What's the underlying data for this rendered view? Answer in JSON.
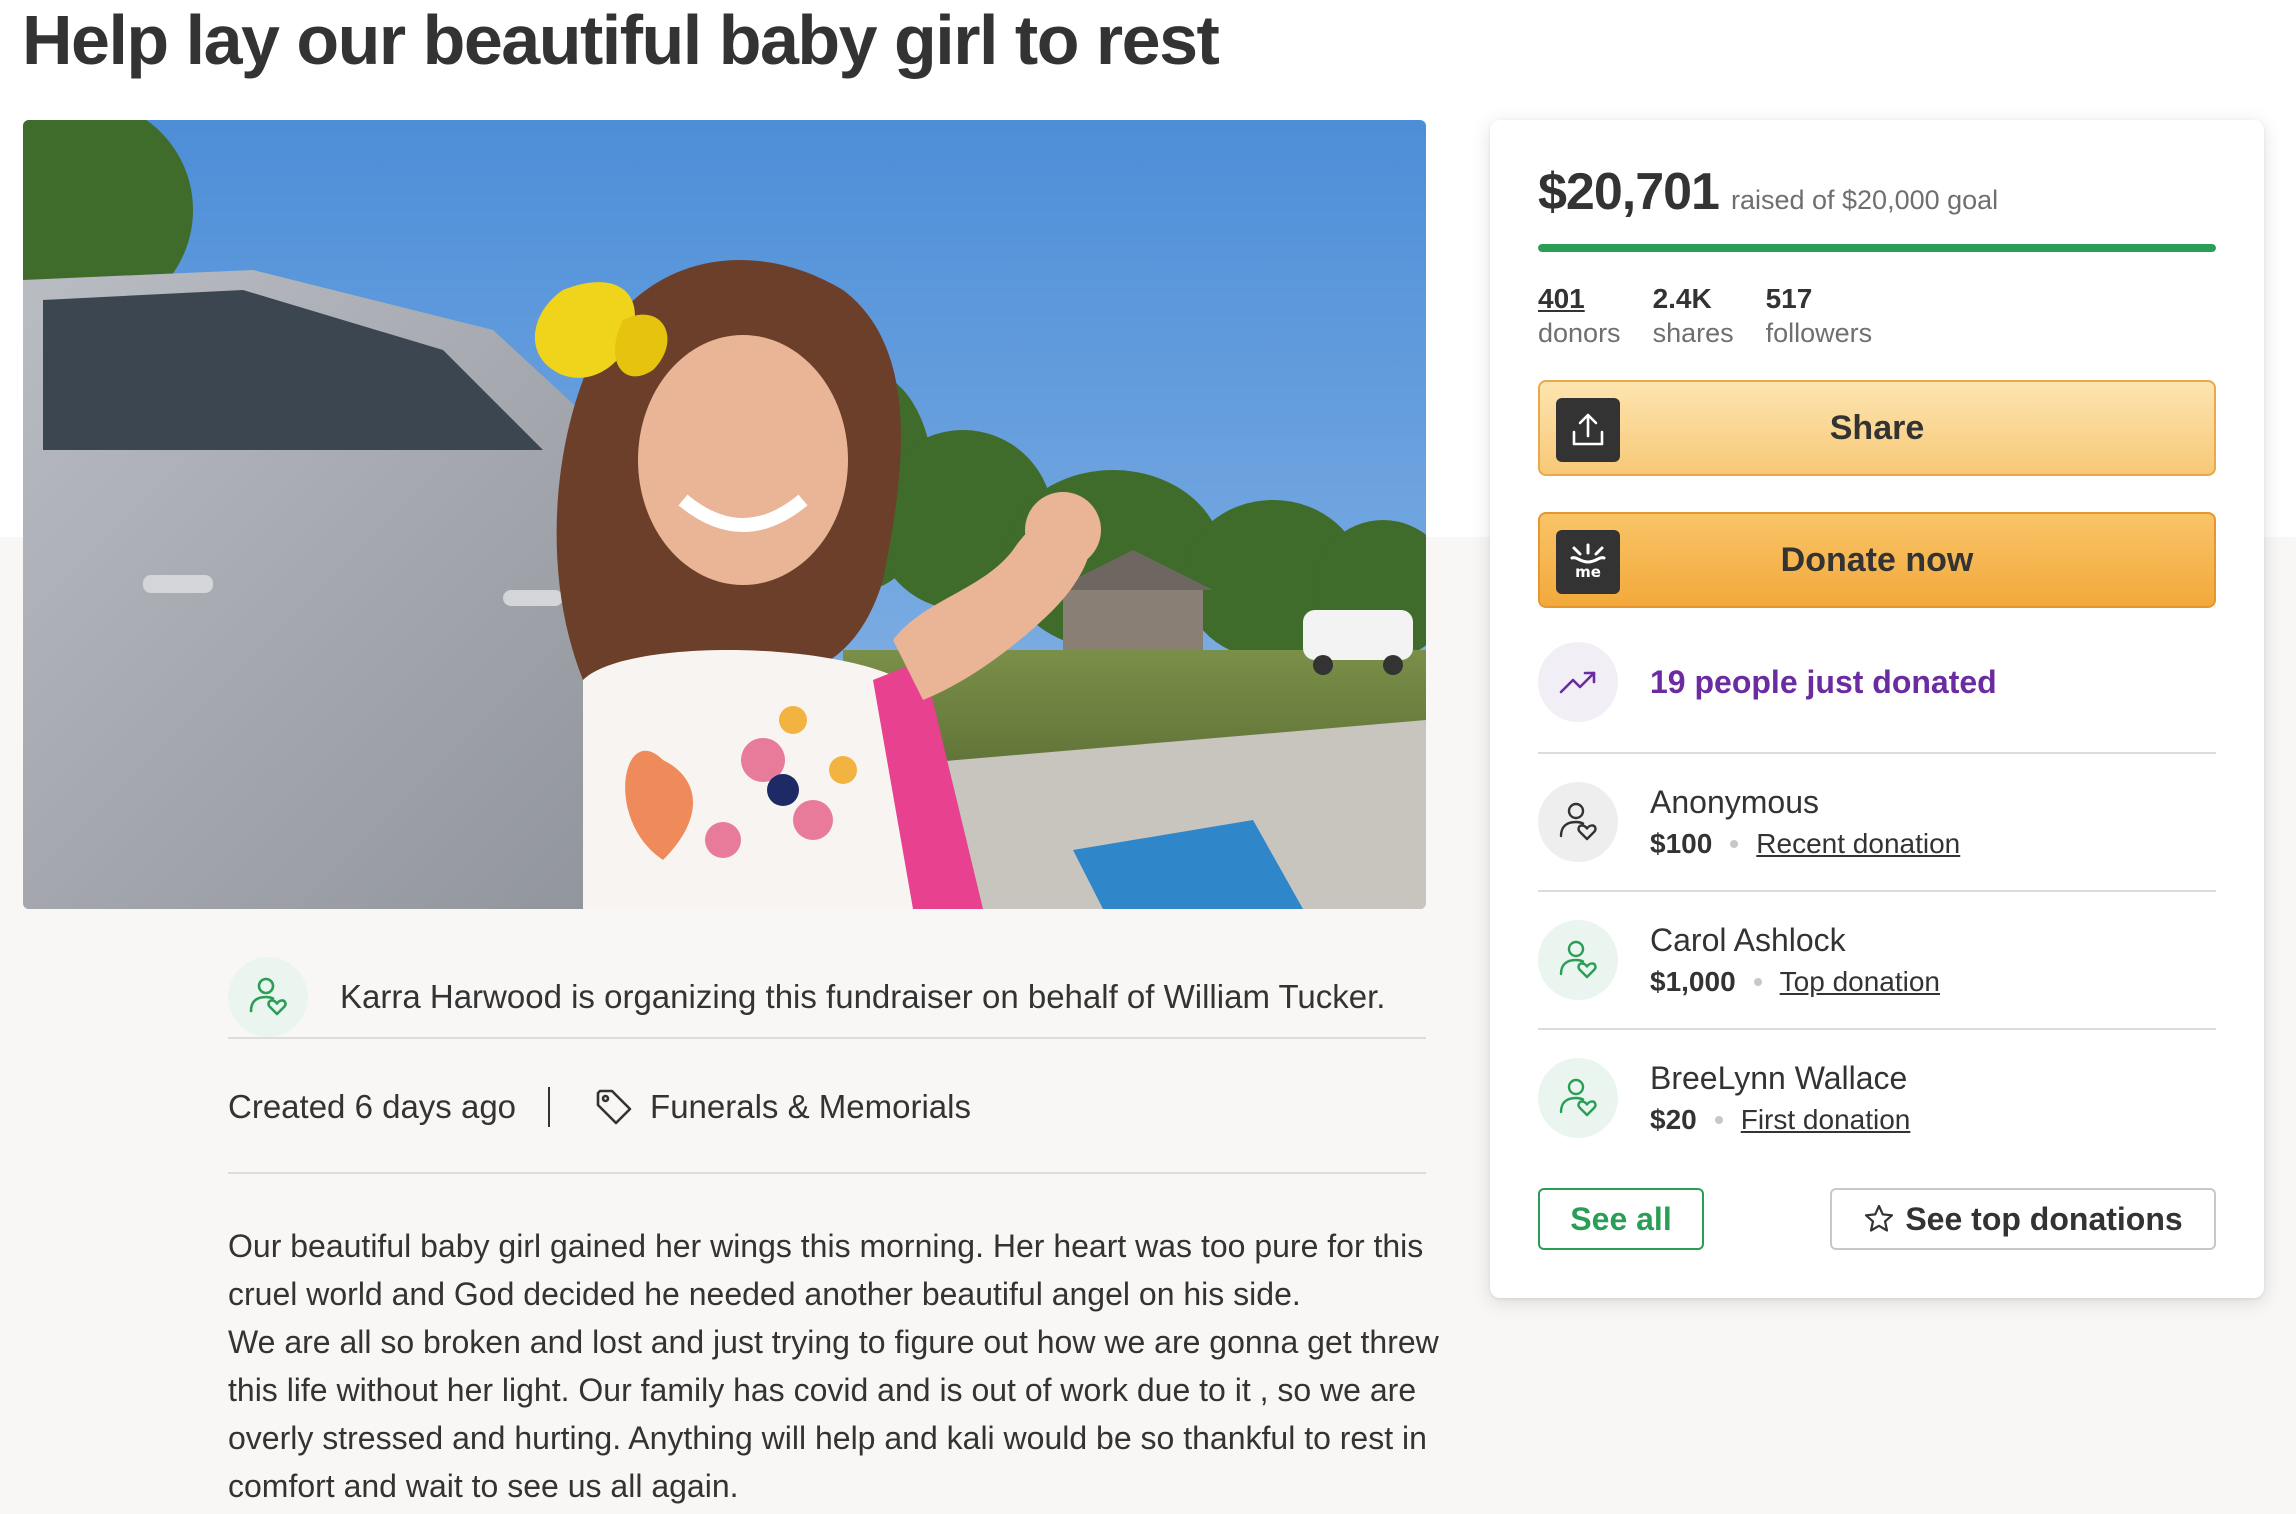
{
  "page": {
    "title": "Help lay our beautiful baby girl to rest"
  },
  "organizer": {
    "text": "Karra Harwood is organizing this fundraiser on behalf of William Tucker."
  },
  "meta": {
    "created": "Created 6 days ago",
    "category": "Funerals & Memorials"
  },
  "story": {
    "paragraphs": [
      "Our beautiful baby girl gained her wings this morning. Her heart was too pure for this cruel world and God decided he needed another beautiful angel on his side.",
      "We are all so broken and lost and just trying to figure out how we are gonna get threw this life without her light. Our family has covid and is out of work due to it , so we are overly stressed and hurting. Anything will help and kali would be so thankful to rest in comfort and wait to see us all again."
    ]
  },
  "card": {
    "amount_raised": "$20,701",
    "goal_text": "raised of $20,000 goal",
    "progress_fraction": 1.0,
    "stats": [
      {
        "value": "401",
        "label": "donors"
      },
      {
        "value": "2.4K",
        "label": "shares"
      },
      {
        "value": "517",
        "label": "followers"
      }
    ],
    "share_label": "Share",
    "share_icon": "upload-share-icon",
    "donate_label": "Donate now",
    "donate_icon": "gofundme-logo-icon",
    "trend_text": "19 people just donated",
    "trend_icon": "trending-up-icon",
    "donations": [
      {
        "name": "Anonymous",
        "amount": "$100",
        "tag": "Recent donation"
      },
      {
        "name": "Carol Ashlock",
        "amount": "$1,000",
        "tag": "Top donation"
      },
      {
        "name": "BreeLynn Wallace",
        "amount": "$20",
        "tag": "First donation"
      }
    ],
    "see_all_label": "See all",
    "see_top_label": "See top donations"
  },
  "colors": {
    "brand_green": "#2a9d56",
    "donate_orange": "#f3a93a",
    "share_yellow": "#fde5b0",
    "trend_purple": "#6b2ba1"
  }
}
